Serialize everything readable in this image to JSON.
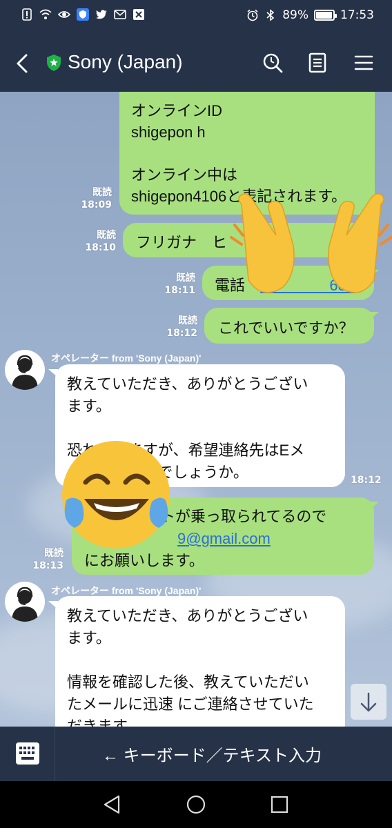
{
  "status_bar": {
    "battery": "89%",
    "battery_level": 0.89,
    "time": "17:53",
    "icons": [
      "sim-alert-icon",
      "wifi-icon",
      "eye-icon",
      "vpn-shield-icon",
      "twitter-icon",
      "gmail-icon",
      "close-box-icon",
      "alarm-icon",
      "bluetooth-icon"
    ]
  },
  "header": {
    "title": "Sony (Japan)",
    "colors": {
      "bar": "#263248",
      "badge": "#1fb04a"
    }
  },
  "messages": [
    {
      "type": "out",
      "lines": [
        "オンラインID",
        "shigepon h",
        "",
        "オンライン中は",
        "shigepon4106と表記されます。"
      ],
      "read": "既読",
      "time": "18:09"
    },
    {
      "type": "out",
      "lines": [
        "フリガナ　ヒ"
      ],
      "read": "既読",
      "time": "18:10"
    },
    {
      "type": "out",
      "label": "電話",
      "link": "0　　　　680",
      "read": "既読",
      "time": "18:11"
    },
    {
      "type": "out",
      "lines": [
        "これでいいですか？"
      ],
      "read": "既読",
      "time": "18:12"
    },
    {
      "type": "in",
      "sender": "オペレーター from 'Sony (Japan)'",
      "lines": [
        "教えていただき、ありがとうござい",
        "ます。",
        "",
        "恐れ　　ますが、希望連絡先はEメ",
        "　　　　　いでしょうか。"
      ],
      "time": "18:12"
    },
    {
      "type": "out",
      "lines": [
        "　　　　ントが乗っ取られてるので"
      ],
      "link": "9@gmail.com",
      "tail": "にお願いします。",
      "read": "既読",
      "time": "18:13"
    },
    {
      "type": "in",
      "sender": "オペレーター from 'Sony (Japan)'",
      "lines": [
        "教えていただき、ありがとうござい",
        "ます。",
        "",
        "情報を確認した後、教えていただい",
        "たメールに迅速 にご連絡させていた",
        "だきます。"
      ]
    }
  ],
  "colors": {
    "outgoing_bubble": "#a8e07f",
    "incoming_bubble": "#ffffff",
    "link": "#2a6fd8"
  },
  "input_bar": {
    "text": "← キーボード／テキスト入力"
  }
}
